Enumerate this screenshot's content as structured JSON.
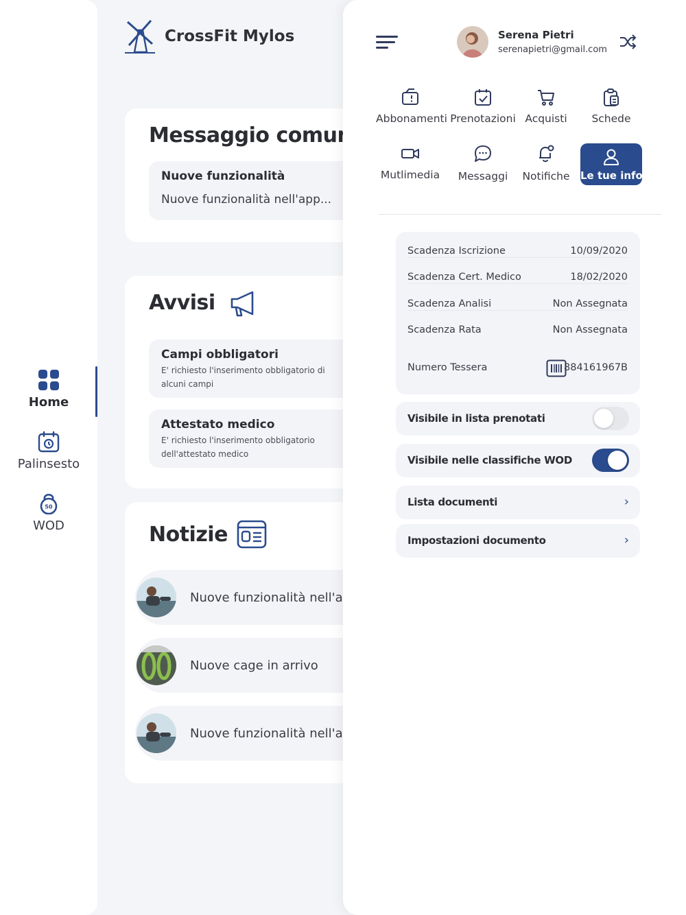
{
  "brand": {
    "name": "CrossFit Mylos"
  },
  "nav": {
    "home": "Home",
    "schedule": "Palinsesto",
    "wod": "WOD",
    "wod_badge": "50"
  },
  "common_message": {
    "title": "Messaggio comune",
    "item_title": "Nuove funzionalità",
    "item_text": "Nuove funzionalità nell'app..."
  },
  "alerts": {
    "title": "Avvisi",
    "items": [
      {
        "title": "Campi obbligatori",
        "desc": "E' richiesto l'inserimento obbligatorio di alcuni campi"
      },
      {
        "title": "Attestato medico",
        "desc": "E' richiesto l'inserimento obbligatorio dell'attestato medico"
      }
    ]
  },
  "news": {
    "title": "Notizie",
    "items": [
      {
        "text": "Nuove funzionalità nell'app"
      },
      {
        "text": "Nuove cage in arrivo"
      },
      {
        "text": "Nuove funzionalità nell'app"
      }
    ]
  },
  "user": {
    "name": "Serena Pietri",
    "email": "serenapietri@gmail.com"
  },
  "menu": {
    "subscriptions": "Abbonamenti",
    "bookings": "Prenotazioni",
    "purchases": "Acquisti",
    "sheets": "Schede",
    "multimedia": "Mutlimedia",
    "messages": "Messaggi",
    "notifications": "Notifiche",
    "your_info": "Le tue info"
  },
  "info": {
    "rows": [
      {
        "label": "Scadenza Iscrizione",
        "value": "10/09/2020"
      },
      {
        "label": "Scadenza Cert. Medico",
        "value": "18/02/2020"
      },
      {
        "label": "Scadenza Analisi",
        "value": "Non Assegnata"
      },
      {
        "label": "Scadenza Rata",
        "value": "Non Assegnata"
      }
    ],
    "card_label": "Numero Tessera",
    "card_number": "884161967B"
  },
  "settings": {
    "visible_booked": {
      "label": "Visibile in lista prenotati",
      "enabled": false
    },
    "visible_wod": {
      "label": "Visibile nelle classifiche WOD",
      "enabled": true
    },
    "documents": "Lista documenti",
    "document_settings": "Impostazioni documento"
  },
  "colors": {
    "accent": "#2a4b8d",
    "text": "#2b2d33",
    "surface": "#f3f4f8"
  }
}
